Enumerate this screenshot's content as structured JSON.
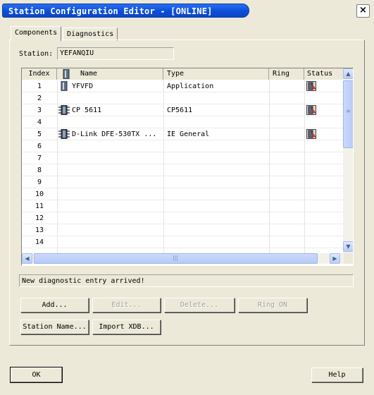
{
  "window": {
    "title": "Station Configuration Editor - [ONLINE]",
    "close_label": "×"
  },
  "tabs": [
    {
      "label": "Components",
      "active": true
    },
    {
      "label": "Diagnostics",
      "active": false
    }
  ],
  "station": {
    "label": "Station:",
    "value": "YEFANQIU"
  },
  "table": {
    "columns": [
      "Index",
      "Name",
      "Type",
      "Ring",
      "Status"
    ],
    "rows": [
      {
        "index": "1",
        "name": "YFVFD",
        "type": "Application",
        "ring": "",
        "name_icon": "application-icon",
        "status_icon": "status-diagnostic-icon"
      },
      {
        "index": "2",
        "name": "",
        "type": "",
        "ring": "",
        "name_icon": "",
        "status_icon": ""
      },
      {
        "index": "3",
        "name": "CP 5611",
        "type": "CP5611",
        "ring": "",
        "name_icon": "network-card-icon",
        "status_icon": "status-diagnostic-icon"
      },
      {
        "index": "4",
        "name": "",
        "type": "",
        "ring": "",
        "name_icon": "",
        "status_icon": ""
      },
      {
        "index": "5",
        "name": "D-Link DFE-530TX ...",
        "type": "IE General",
        "ring": "",
        "name_icon": "network-card-icon",
        "status_icon": "status-diagnostic-icon"
      },
      {
        "index": "6",
        "name": "",
        "type": "",
        "ring": "",
        "name_icon": "",
        "status_icon": ""
      },
      {
        "index": "7",
        "name": "",
        "type": "",
        "ring": "",
        "name_icon": "",
        "status_icon": ""
      },
      {
        "index": "8",
        "name": "",
        "type": "",
        "ring": "",
        "name_icon": "",
        "status_icon": ""
      },
      {
        "index": "9",
        "name": "",
        "type": "",
        "ring": "",
        "name_icon": "",
        "status_icon": ""
      },
      {
        "index": "10",
        "name": "",
        "type": "",
        "ring": "",
        "name_icon": "",
        "status_icon": ""
      },
      {
        "index": "11",
        "name": "",
        "type": "",
        "ring": "",
        "name_icon": "",
        "status_icon": ""
      },
      {
        "index": "12",
        "name": "",
        "type": "",
        "ring": "",
        "name_icon": "",
        "status_icon": ""
      },
      {
        "index": "13",
        "name": "",
        "type": "",
        "ring": "",
        "name_icon": "",
        "status_icon": ""
      },
      {
        "index": "14",
        "name": "",
        "type": "",
        "ring": "",
        "name_icon": "",
        "status_icon": ""
      }
    ]
  },
  "message": "New diagnostic entry arrived!",
  "buttons": {
    "add": "Add...",
    "edit": "Edit...",
    "delete": "Delete...",
    "ring_on": "Ring ON",
    "station_name": "Station Name...",
    "import_xdb": "Import XDB...",
    "ok": "OK",
    "help": "Help"
  }
}
